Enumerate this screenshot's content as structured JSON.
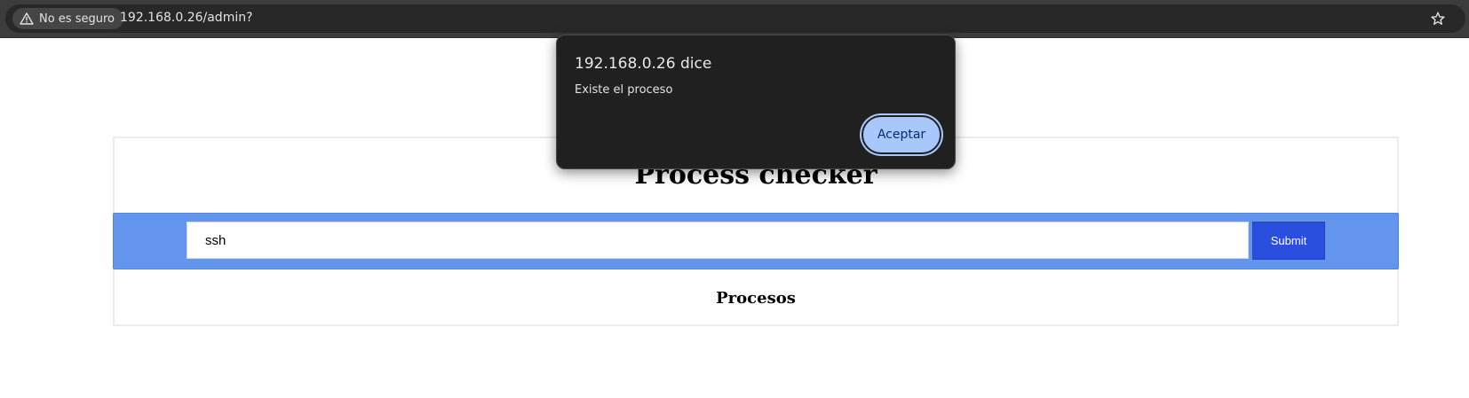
{
  "browser": {
    "security_label": "No es seguro",
    "url": "192.168.0.26/admin?"
  },
  "page": {
    "title": "Process checker",
    "search_value": "ssh",
    "submit_label": "Submit",
    "section_heading": "Procesos"
  },
  "dialog": {
    "title": "192.168.0.26 dice",
    "message": "Existe el proceso",
    "ok_label": "Aceptar"
  },
  "colors": {
    "form_band": "#6495ed",
    "submit_button": "#2a4fdf",
    "dialog_bg": "#202020",
    "dialog_button": "#a8c7fa"
  },
  "icons": [
    "warning-icon",
    "bookmark-star-icon"
  ]
}
